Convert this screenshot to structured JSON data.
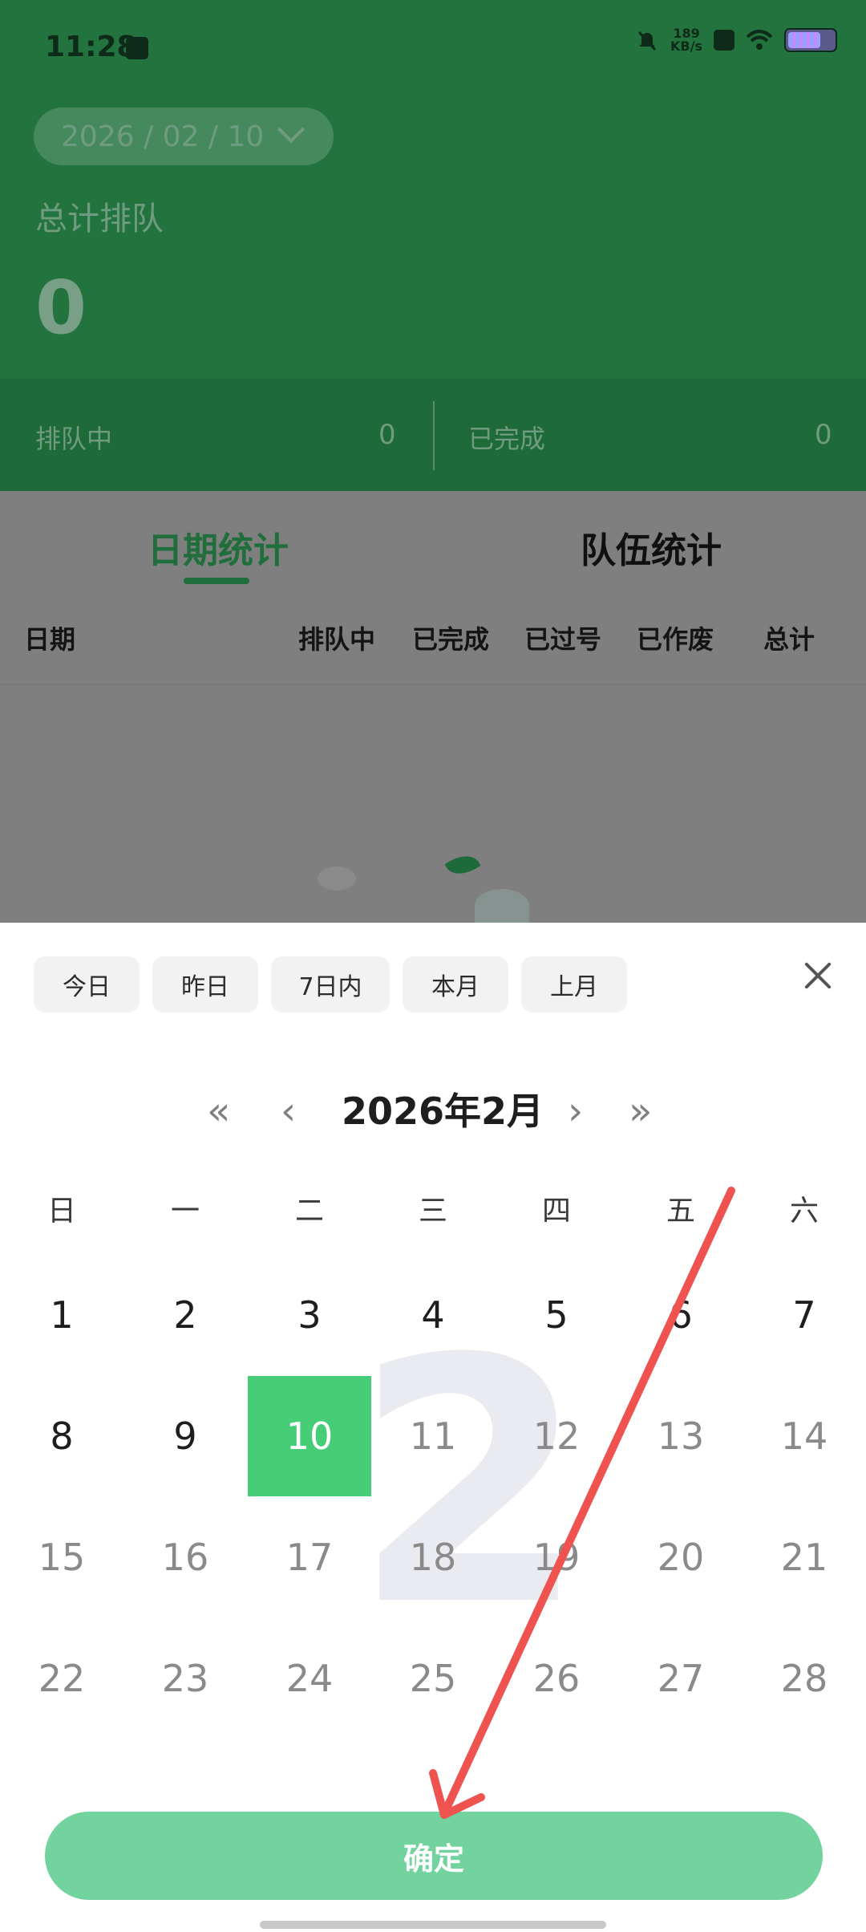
{
  "status_bar": {
    "time": "11:28",
    "net_speed_value": "189",
    "net_speed_unit": "KB/s",
    "icons": [
      "calendar-icon",
      "mute-icon",
      "x-icon",
      "wifi-icon",
      "battery-icon"
    ]
  },
  "header": {
    "date_selector": "2026 / 02 / 10",
    "total_label": "总计排队",
    "total_value": "0",
    "queuing_label": "排队中",
    "queuing_value": "0",
    "completed_label": "已完成",
    "completed_value": "0"
  },
  "tabs": [
    {
      "label": "日期统计",
      "active": true
    },
    {
      "label": "队伍统计",
      "active": false
    }
  ],
  "table": {
    "columns": [
      "日期",
      "排队中",
      "已完成",
      "已过号",
      "已作废",
      "总计"
    ]
  },
  "date_picker": {
    "quick_ranges": [
      "今日",
      "昨日",
      "7日内",
      "本月",
      "上月"
    ],
    "prev_year": "«",
    "prev_month": "‹",
    "month_title": "2026年2月",
    "next_month": "›",
    "next_year": "»",
    "weekdays": [
      "日",
      "一",
      "二",
      "三",
      "四",
      "五",
      "六"
    ],
    "watermark_month": "2",
    "weeks": [
      [
        "1",
        "2",
        "3",
        "4",
        "5",
        "6",
        "7"
      ],
      [
        "8",
        "9",
        "10",
        "11",
        "12",
        "13",
        "14"
      ],
      [
        "15",
        "16",
        "17",
        "18",
        "19",
        "20",
        "21"
      ],
      [
        "22",
        "23",
        "24",
        "25",
        "26",
        "27",
        "28"
      ]
    ],
    "selected_day": "10",
    "confirm": "确定"
  },
  "colors": {
    "header_green": "#23733f",
    "selected_day": "#47cc77",
    "confirm_button": "#72d39e",
    "annotation_arrow": "#ef5350"
  }
}
